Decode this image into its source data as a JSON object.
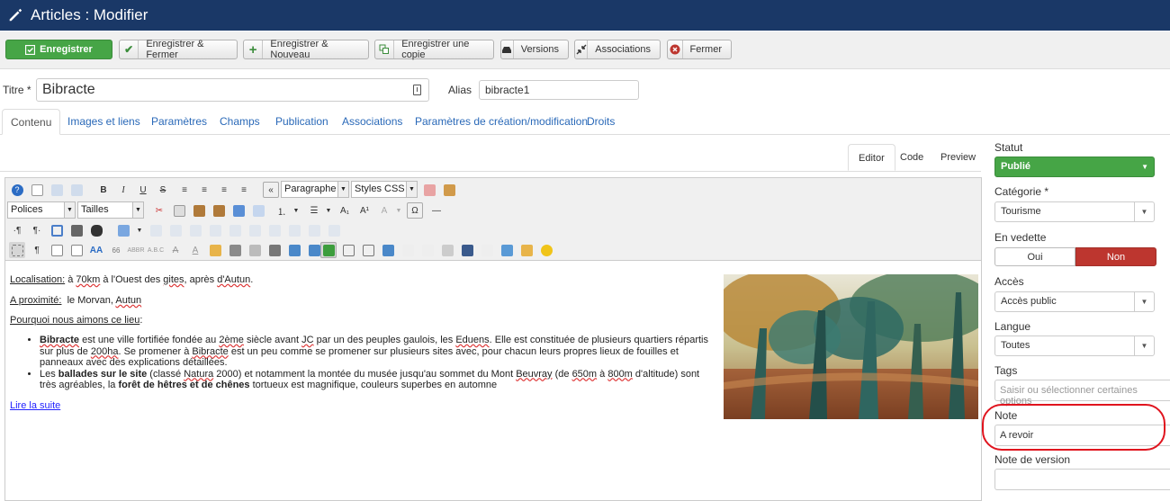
{
  "header": {
    "title": "Articles : Modifier",
    "icon": "pencil-icon"
  },
  "toolbar": {
    "save": "Enregistrer",
    "save_close": "Enregistrer & Fermer",
    "save_new": "Enregistrer & Nouveau",
    "save_copy": "Enregistrer une copie",
    "versions": "Versions",
    "associations": "Associations",
    "close": "Fermer"
  },
  "form": {
    "title_label": "Titre *",
    "title_value": "Bibracte",
    "alias_label": "Alias",
    "alias_value": "bibracte1"
  },
  "tabs": [
    "Contenu",
    "Images et liens",
    "Paramètres",
    "Champs",
    "Publication",
    "Associations",
    "Paramètres de création/modification",
    "Droits"
  ],
  "editor_modes": [
    "Editor",
    "Code",
    "Preview"
  ],
  "editor_toolbar": {
    "format_select": "Paragraphe",
    "styles_select": "Styles CSS",
    "fonts_select": "Polices",
    "sizes_select": "Tailles"
  },
  "content": {
    "loc_label": "Localisation:",
    "loc_text_1": " à ",
    "loc_dist": "70km",
    "loc_text_2": " à l'Ouest des ",
    "loc_gites": "gites",
    "loc_text_3": ", après ",
    "loc_town": "d'Autun",
    "loc_text_4": ".",
    "prox_label": "A proximité:",
    "prox_text": "  le Morvan, ",
    "prox_town": "Autun",
    "why_label": "Pourquoi nous aimons ce lieu",
    "why_colon": ":",
    "li1_bold": "Bibracte",
    "li1_a": " est une ville fortifiée fondée au ",
    "li1_cent": "2ème",
    "li1_b": " siècle avant ",
    "li1_jc": "JC",
    "li1_c": " par un des peuples gaulois, les ",
    "li1_eduens": "Eduens",
    "li1_d": ". Elle est constituée de plusieurs quartiers répartis sur plus de ",
    "li1_ha": "200ha",
    "li1_e": ". Se promener à ",
    "li1_bib": "Bibracte",
    "li1_f": " est un peu comme se promener sur plusieurs sites avec, pour chacun leurs propres lieux de fouilles et panneaux avec des explications détaillées.",
    "li2_a": "Les ",
    "li2_bold1": "ballades sur le site",
    "li2_b": " (classé ",
    "li2_natura": "Natura",
    "li2_c": " 2000) et notamment la montée du musée jusqu'au sommet du Mont ",
    "li2_beuvray": "Beuvray",
    "li2_d": " (de ",
    "li2_650": "650m",
    "li2_e": " à ",
    "li2_800": "800m",
    "li2_f": " d'altitude) sont très agréables, la ",
    "li2_bold2": "forêt de hêtres et de chênes",
    "li2_g": " tortueux est magnifique, couleurs superbes en automne",
    "readmore": "Lire la suite"
  },
  "sidebar": {
    "status_label": "Statut",
    "status_value": "Publié",
    "category_label": "Catégorie *",
    "category_value": "Tourisme",
    "featured_label": "En vedette",
    "featured_yes": "Oui",
    "featured_no": "Non",
    "featured_selected": "Non",
    "access_label": "Accès",
    "access_value": "Accès public",
    "language_label": "Langue",
    "language_value": "Toutes",
    "tags_label": "Tags",
    "tags_placeholder": "Saisir ou sélectionner certaines options",
    "note_label": "Note",
    "note_value": "A revoir",
    "version_note_label": "Note de version",
    "version_note_value": ""
  },
  "colors": {
    "header_bg": "#1a3867",
    "success": "#46a546",
    "danger": "#bd362f",
    "link": "#2a69b8",
    "highlight_circle": "#e0141e"
  }
}
